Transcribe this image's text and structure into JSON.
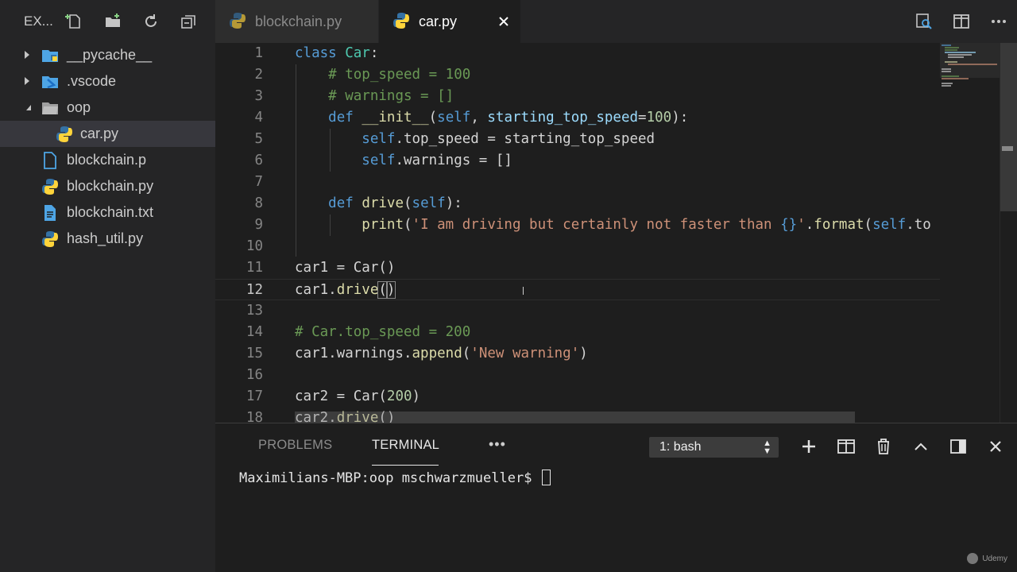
{
  "explorer": {
    "title": "EX...",
    "actions": [
      "new-file-icon",
      "new-folder-icon",
      "refresh-icon",
      "collapse-all-icon"
    ],
    "items": [
      {
        "label": "__pycache__",
        "type": "folder",
        "expanded": false,
        "depth": 0,
        "icon": "folder-icon"
      },
      {
        "label": ".vscode",
        "type": "folder",
        "expanded": false,
        "depth": 0,
        "icon": "vscode-folder-icon"
      },
      {
        "label": "oop",
        "type": "folder",
        "expanded": true,
        "depth": 0,
        "icon": "folder-open-icon"
      },
      {
        "label": "car.py",
        "type": "file",
        "depth": 1,
        "icon": "python-icon",
        "selected": true
      },
      {
        "label": "blockchain.p",
        "type": "file",
        "depth": 0,
        "icon": "file-icon"
      },
      {
        "label": "blockchain.py",
        "type": "file",
        "depth": 0,
        "icon": "python-icon"
      },
      {
        "label": "blockchain.txt",
        "type": "file",
        "depth": 0,
        "icon": "text-file-icon"
      },
      {
        "label": "hash_util.py",
        "type": "file",
        "depth": 0,
        "icon": "python-icon"
      }
    ]
  },
  "tabs": [
    {
      "label": "blockchain.py",
      "active": false
    },
    {
      "label": "car.py",
      "active": true
    }
  ],
  "editor": {
    "current_line": 12,
    "lines": [
      {
        "n": "1",
        "tokens": [
          [
            "kw",
            "class "
          ],
          [
            "cls",
            "Car"
          ],
          [
            "def",
            ":"
          ]
        ]
      },
      {
        "n": "2",
        "tokens": [
          [
            "def",
            "    "
          ],
          [
            "com",
            "# top_speed = 100"
          ]
        ]
      },
      {
        "n": "3",
        "tokens": [
          [
            "def",
            "    "
          ],
          [
            "com",
            "# warnings = []"
          ]
        ]
      },
      {
        "n": "4",
        "tokens": [
          [
            "def",
            "    "
          ],
          [
            "kw",
            "def "
          ],
          [
            "fn",
            "__init__"
          ],
          [
            "def",
            "("
          ],
          [
            "self",
            "self"
          ],
          [
            "def",
            ", "
          ],
          [
            "param",
            "starting_top_speed"
          ],
          [
            "def",
            "="
          ],
          [
            "num",
            "100"
          ],
          [
            "def",
            "):"
          ]
        ]
      },
      {
        "n": "5",
        "tokens": [
          [
            "def",
            "        "
          ],
          [
            "self",
            "self"
          ],
          [
            "def",
            ".top_speed = starting_top_speed"
          ]
        ]
      },
      {
        "n": "6",
        "tokens": [
          [
            "def",
            "        "
          ],
          [
            "self",
            "self"
          ],
          [
            "def",
            ".warnings = []"
          ]
        ]
      },
      {
        "n": "7",
        "tokens": []
      },
      {
        "n": "8",
        "tokens": [
          [
            "def",
            "    "
          ],
          [
            "kw",
            "def "
          ],
          [
            "fn",
            "drive"
          ],
          [
            "def",
            "("
          ],
          [
            "self",
            "self"
          ],
          [
            "def",
            "):"
          ]
        ]
      },
      {
        "n": "9",
        "tokens": [
          [
            "def",
            "        "
          ],
          [
            "fn",
            "print"
          ],
          [
            "def",
            "("
          ],
          [
            "str",
            "'I am driving but certainly not faster than "
          ],
          [
            "kw",
            "{}"
          ],
          [
            "str",
            "'"
          ],
          [
            "def",
            "."
          ],
          [
            "fn",
            "format"
          ],
          [
            "def",
            "("
          ],
          [
            "self",
            "self"
          ],
          [
            "def",
            ".to"
          ]
        ]
      },
      {
        "n": "10",
        "tokens": []
      },
      {
        "n": "11",
        "tokens": [
          [
            "def",
            "car1 = Car()"
          ]
        ]
      },
      {
        "n": "12",
        "tokens": [
          [
            "def",
            "car1."
          ],
          [
            "fn",
            "drive"
          ],
          [
            "bracket",
            "("
          ],
          [
            "bracket",
            ")"
          ]
        ]
      },
      {
        "n": "13",
        "tokens": []
      },
      {
        "n": "14",
        "tokens": [
          [
            "com",
            "# Car.top_speed = 200"
          ]
        ]
      },
      {
        "n": "15",
        "tokens": [
          [
            "def",
            "car1.warnings."
          ],
          [
            "fn",
            "append"
          ],
          [
            "def",
            "("
          ],
          [
            "str",
            "'New warning'"
          ],
          [
            "def",
            ")"
          ]
        ]
      },
      {
        "n": "16",
        "tokens": []
      },
      {
        "n": "17",
        "tokens": [
          [
            "def",
            "car2 = Car("
          ],
          [
            "num",
            "200"
          ],
          [
            "def",
            ")"
          ]
        ]
      },
      {
        "n": "18",
        "tokens": [
          [
            "def",
            "car2."
          ],
          [
            "fn",
            "drive"
          ],
          [
            "def",
            "()"
          ]
        ]
      }
    ]
  },
  "panel": {
    "tabs": [
      {
        "label": "PROBLEMS",
        "active": false
      },
      {
        "label": "TERMINAL",
        "active": true
      }
    ],
    "more": "•••",
    "terminal_select": "1: bash",
    "actions": [
      "add-icon",
      "split-icon",
      "trash-icon",
      "chevron-up-icon",
      "panel-layout-icon",
      "close-icon"
    ],
    "prompt": "Maximilians-MBP:oop mschwarzmueller$"
  },
  "watermark": "Udemy",
  "colors": {
    "accent_python_blue": "#3572A5",
    "accent_python_yellow": "#FFD43B",
    "folder_blue": "#4ea5e5",
    "editor_bg": "#1e1e1e",
    "sidebar_bg": "#252526"
  }
}
